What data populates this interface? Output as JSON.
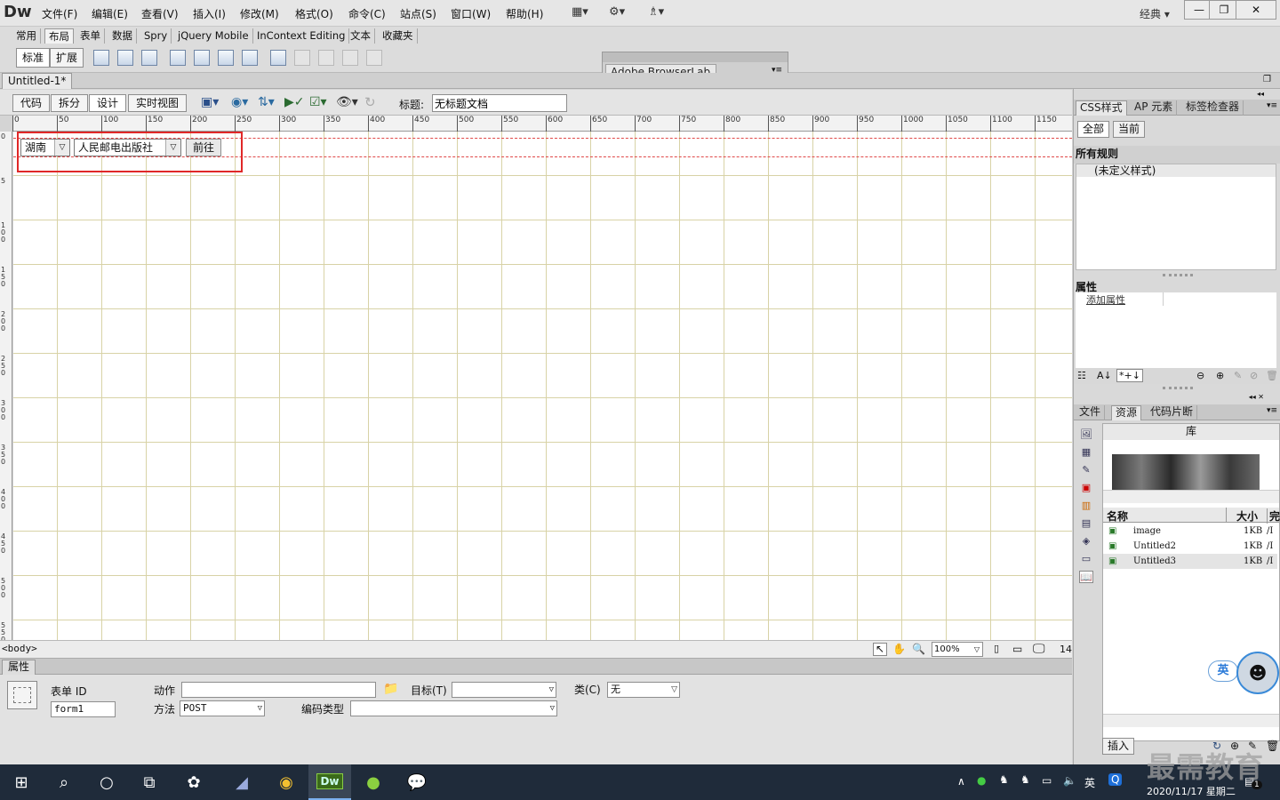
{
  "app": {
    "logo": "Dw",
    "workspace": "经典"
  },
  "menu": [
    "文件(F)",
    "编辑(E)",
    "查看(V)",
    "插入(I)",
    "修改(M)",
    "格式(O)",
    "命令(C)",
    "站点(S)",
    "窗口(W)",
    "帮助(H)"
  ],
  "insert_tabs": [
    "常用",
    "布局",
    "表单",
    "数据",
    "Spry",
    "jQuery Mobile",
    "InContext Editing",
    "文本",
    "收藏夹"
  ],
  "insert_mode": {
    "standard": "标准",
    "expanded": "扩展"
  },
  "browserlab": {
    "tab": "Adobe BrowserLab"
  },
  "document": {
    "tab": "Untitled-1*"
  },
  "doc_toolbar": {
    "code": "代码",
    "split": "拆分",
    "design": "设计",
    "live": "实时视图",
    "title_label": "标题:",
    "title_value": "无标题文档"
  },
  "ruler": {
    "h": [
      "0",
      "50",
      "100",
      "150",
      "200",
      "250",
      "300",
      "350",
      "400",
      "450",
      "500",
      "550",
      "600",
      "650",
      "700",
      "750",
      "800",
      "850",
      "900",
      "950",
      "1000",
      "1050",
      "1100",
      "1150"
    ],
    "v": [
      "0",
      "5",
      "1\n0\n0",
      "1\n5\n0",
      "2\n0\n0",
      "2\n5\n0",
      "3\n0\n0",
      "3\n5\n0",
      "4\n0\n0",
      "4\n5\n0",
      "5\n0\n0",
      "5\n5\n0"
    ]
  },
  "form": {
    "select1": "湖南",
    "select2": "人民邮电出版社",
    "go_button": "前往"
  },
  "status": {
    "tag": "<body>",
    "zoom": "100%",
    "size": "14:"
  },
  "props": {
    "tab": "属性",
    "form_id_label": "表单 ID",
    "form_id": "form1",
    "action_label": "动作",
    "action": "",
    "target_label": "目标(T)",
    "target": "",
    "class_label": "类(C)",
    "class_value": "无",
    "method_label": "方法",
    "method": "POST",
    "enctype_label": "编码类型",
    "enctype": ""
  },
  "css_panel": {
    "tabs": [
      "CSS样式",
      "AP 元素",
      "标签检查器"
    ],
    "all": "全部",
    "current": "当前",
    "rules_heading": "所有规则",
    "rule": "(未定义样式)",
    "props_heading": "属性",
    "add_prop": "添加属性"
  },
  "files_panel": {
    "tabs": [
      "文件",
      "资源",
      "代码片断"
    ],
    "lib_title": "库",
    "col_name": "名称",
    "col_size": "大小",
    "col_path": "完",
    "rows": [
      {
        "name": "image",
        "size": "1KB",
        "path": "/I"
      },
      {
        "name": "Untitled2",
        "size": "1KB",
        "path": "/I"
      },
      {
        "name": "Untitled3",
        "size": "1KB",
        "path": "/I"
      }
    ],
    "insert": "插入"
  },
  "ime": "英",
  "taskbar": {
    "ime": "英",
    "date": "2020/11/17 星期二",
    "badge": "1"
  },
  "watermark": "最需教育",
  "colors": {
    "grid": "#d8d2a6",
    "form_border": "#e04848",
    "highlight": "#e02828",
    "taskbar": "#1f2b3a"
  }
}
